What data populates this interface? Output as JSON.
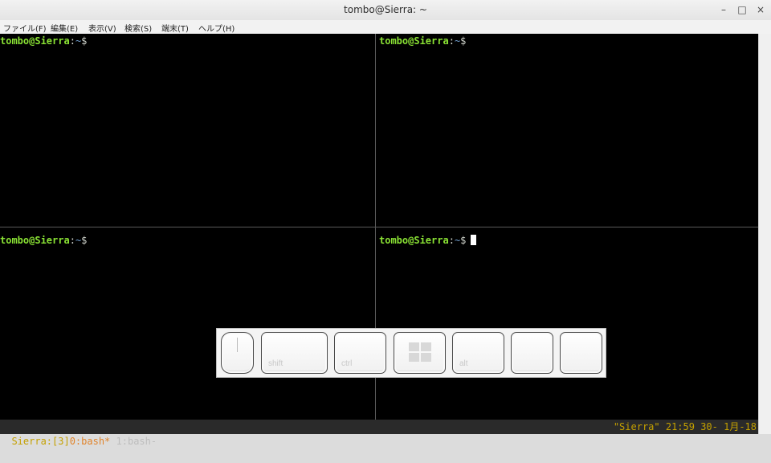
{
  "window": {
    "title": "tombo@Sierra: ~",
    "controls": {
      "minimize": "–",
      "maximize": "□",
      "close": "×"
    }
  },
  "menu": [
    "ファイル(F)",
    "編集(E)",
    "表示(V)",
    "検索(S)",
    "端末(T)",
    "ヘルプ(H)"
  ],
  "panes": [
    {
      "user": "tombo@Sierra",
      "colon": ":",
      "dir": "~",
      "sign": "$",
      "cursor": false
    },
    {
      "user": "tombo@Sierra",
      "colon": ":",
      "dir": "~",
      "sign": "$",
      "cursor": false
    },
    {
      "user": "tombo@Sierra",
      "colon": ":",
      "dir": "~",
      "sign": "$",
      "cursor": false
    },
    {
      "user": "tombo@Sierra",
      "colon": ":",
      "dir": "~",
      "sign": "$",
      "cursor": true
    }
  ],
  "status": {
    "session": "Sierra:[3]",
    "active_window": "0:bash*",
    "inactive_window": "1:bash-",
    "right": "\"Sierra\" 21:59 30- 1月-18"
  },
  "keys": {
    "shift": "shift",
    "ctrl": "ctrl",
    "alt": "alt"
  },
  "colors": {
    "prompt_user": "#8ae234",
    "prompt_dir": "#729fcf",
    "status_text": "#c4a000",
    "status_active": "#e0852d",
    "terminal_bg": "#000000"
  }
}
